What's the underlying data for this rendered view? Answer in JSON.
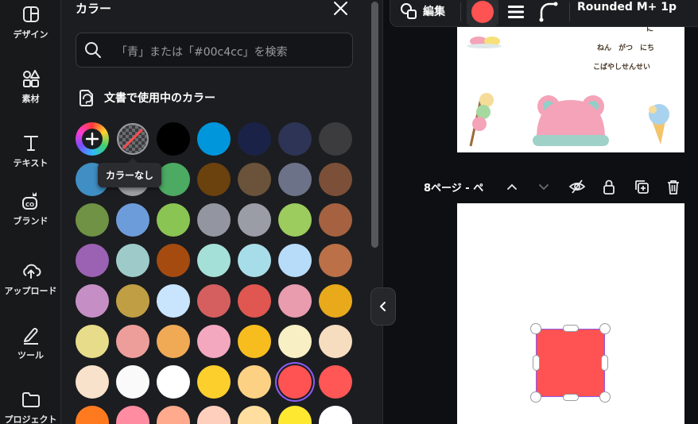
{
  "sidebar": {
    "items": [
      {
        "label": "デザイン",
        "icon": "design-icon"
      },
      {
        "label": "素材",
        "icon": "elements-icon"
      },
      {
        "label": "テキスト",
        "icon": "text-icon"
      },
      {
        "label": "ブランド",
        "icon": "brand-icon"
      },
      {
        "label": "アップロード",
        "icon": "upload-icon"
      },
      {
        "label": "ツール",
        "icon": "tools-icon"
      },
      {
        "label": "プロジェクト",
        "icon": "folder-icon"
      }
    ]
  },
  "color_panel": {
    "title": "カラー",
    "search_placeholder": "「青」または「#00c4cc」を検索",
    "section_title": "文書で使用中のカラー",
    "tooltip": "カラーなし",
    "swatches": [
      [
        "rainbow",
        "none",
        "#000000",
        "#0096dc",
        "#1a2347",
        "#2d3456",
        "#3c3c3e"
      ],
      [
        "#3f8fc4",
        "#9c9ea3",
        "#4caa62",
        "#6b410e",
        "#6a533a",
        "#6c7389",
        "#7c4f38"
      ],
      [
        "#6f9245",
        "#6d9cdb",
        "#8ac553",
        "#9395a0",
        "#9a9ca6",
        "#9bcc5d",
        "#a66240"
      ],
      [
        "#9b61b3",
        "#9ecbc9",
        "#a54b10",
        "#a5e0d8",
        "#a7dde9",
        "#b7dcf9",
        "#bb7048"
      ],
      [
        "#c58fc5",
        "#c09e43",
        "#c9e4fd",
        "#d55f5f",
        "#df5750",
        "#e89cae",
        "#e8a91a"
      ],
      [
        "#e7dc8a",
        "#ee9e9a",
        "#f0aa56",
        "#f4a8c0",
        "#f7bd1e",
        "#f8f0c4",
        "#f7ddc0"
      ],
      [
        "#f8e2cc",
        "#fafafa",
        "#ffffff",
        "#fdcf2d",
        "#fcd184",
        "#ff5252",
        "#ff5656"
      ],
      [
        "#ff7a1f",
        "#ff8ca1",
        "#ffaa8c",
        "#ffcfbe",
        "#ffdea0",
        "#ffe930",
        "#ffffff"
      ]
    ],
    "selected": "#ff5252"
  },
  "toolbar": {
    "edit_label": "編集",
    "current_color": "#ff5252",
    "font_label": "Rounded M+ 1p"
  },
  "canvas": {
    "page1": {
      "text_top": "に",
      "text_line1": "ねん　がつ　にち",
      "text_line2": "こばやしせんせい"
    },
    "page2_label": "8ページ - ペ",
    "shape_color": "#ff5252"
  }
}
